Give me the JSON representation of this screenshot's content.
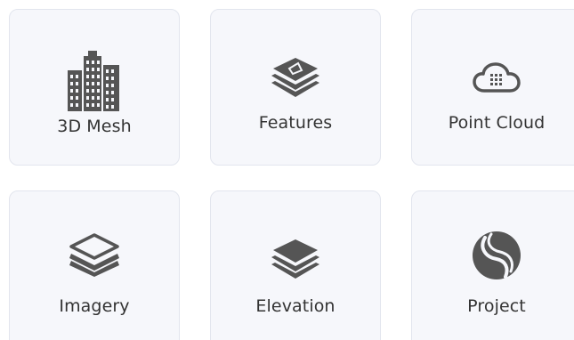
{
  "tiles": [
    {
      "label": "3D Mesh",
      "icon": "buildings-icon"
    },
    {
      "label": "Features",
      "icon": "layers-icon"
    },
    {
      "label": "Point Cloud",
      "icon": "cloud-icon"
    },
    {
      "label": "Imagery",
      "icon": "stack-outline-icon"
    },
    {
      "label": "Elevation",
      "icon": "layers-solid-icon"
    },
    {
      "label": "Project",
      "icon": "project-logo-icon"
    }
  ],
  "colors": {
    "tile_bg": "#f6f7fb",
    "tile_border": "#e2e5ee",
    "icon": "#555555",
    "text": "#333333"
  }
}
